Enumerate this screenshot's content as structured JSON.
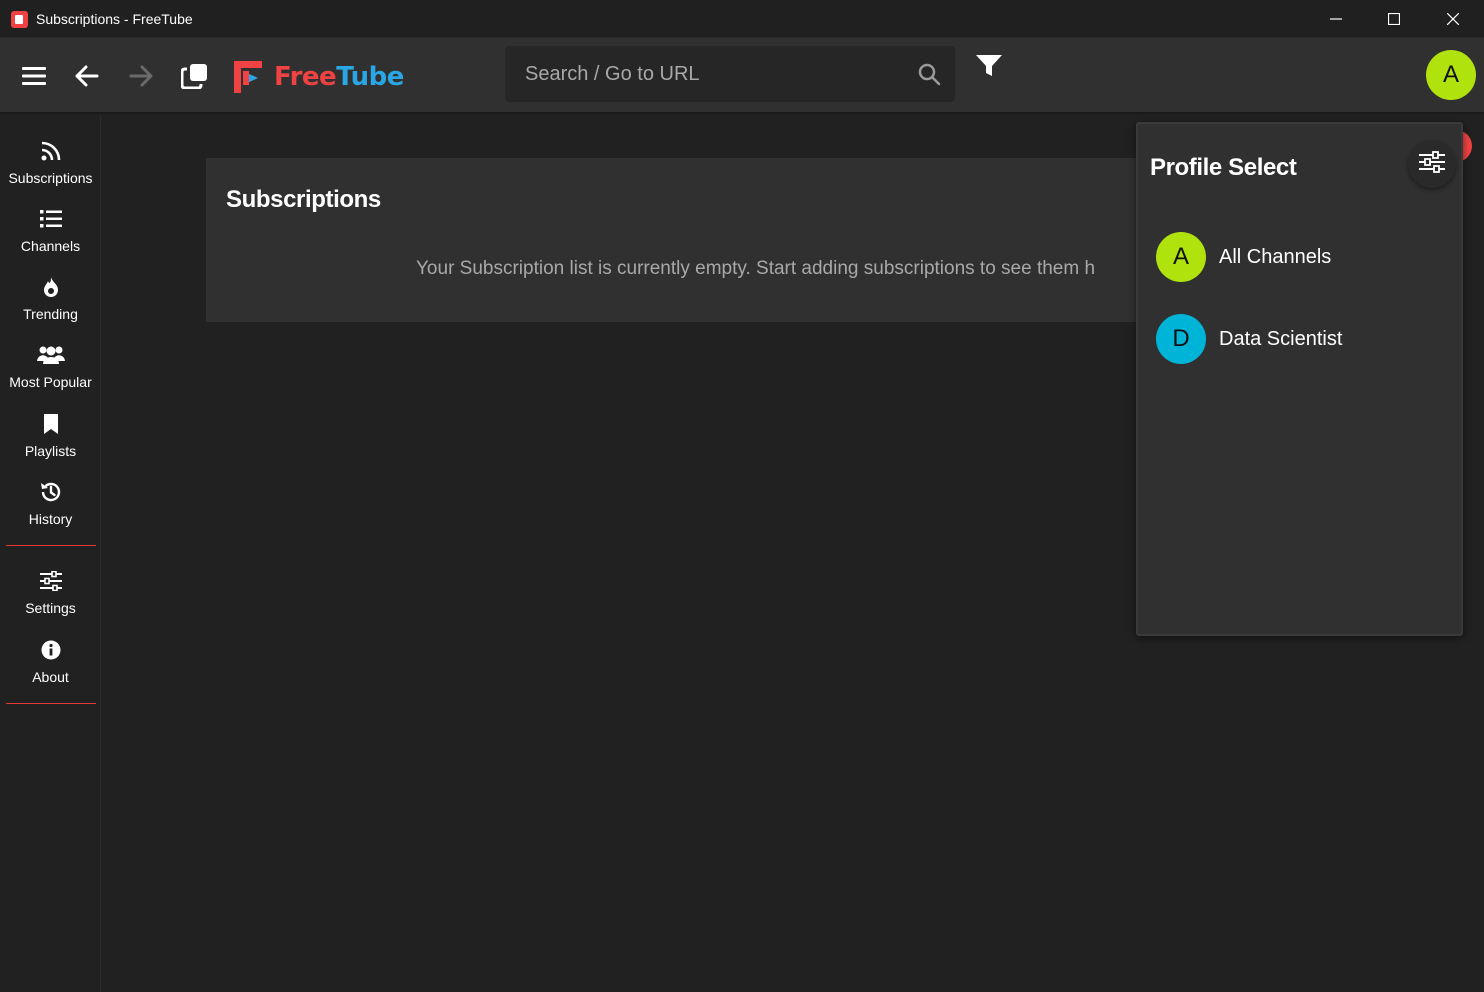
{
  "window": {
    "title": "Subscriptions - FreeTube"
  },
  "topnav": {
    "logo_free": "Free",
    "logo_tube": "Tube",
    "search_placeholder": "Search / Go to URL",
    "profile_initial": "A",
    "profile_color": "#b0e20e"
  },
  "sidebar": {
    "items": [
      {
        "label": "Subscriptions",
        "icon": "rss-icon"
      },
      {
        "label": "Channels",
        "icon": "list-icon"
      },
      {
        "label": "Trending",
        "icon": "fire-icon"
      },
      {
        "label": "Most Popular",
        "icon": "users-icon"
      },
      {
        "label": "Playlists",
        "icon": "bookmark-icon"
      },
      {
        "label": "History",
        "icon": "history-icon"
      },
      {
        "label": "Settings",
        "icon": "sliders-icon"
      },
      {
        "label": "About",
        "icon": "info-icon"
      }
    ]
  },
  "main": {
    "title": "Subscriptions",
    "empty_message": "Your Subscription list is currently empty. Start adding subscriptions to see them h"
  },
  "profile_panel": {
    "title": "Profile Select",
    "profiles": [
      {
        "initial": "A",
        "name": "All Channels",
        "color": "#b0e20e"
      },
      {
        "initial": "D",
        "name": "Data Scientist",
        "color": "#00b4d8"
      }
    ]
  },
  "colors": {
    "accent_red": "#f04242",
    "accent_blue": "#2aa6e4",
    "background": "#212121",
    "card": "#303030"
  }
}
